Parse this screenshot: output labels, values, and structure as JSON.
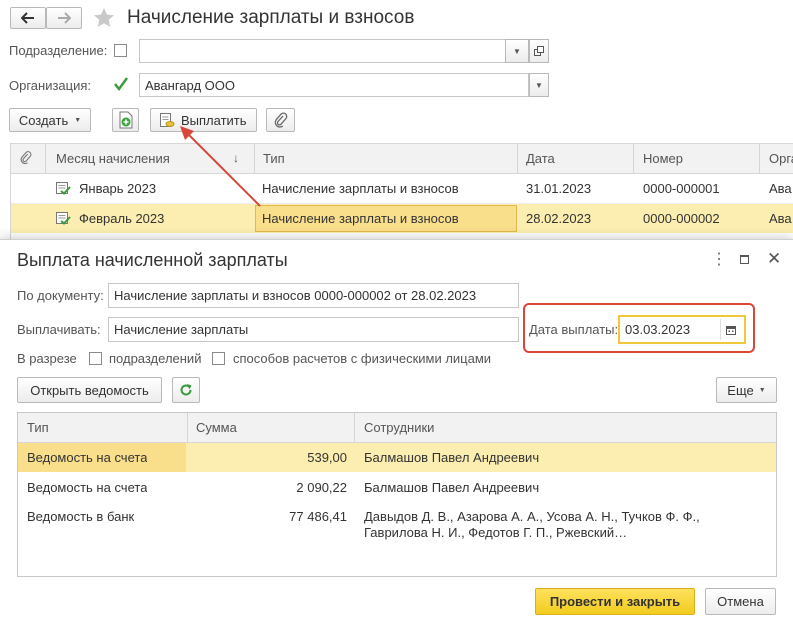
{
  "header": {
    "title": "Начисление зарплаты и взносов",
    "back_icon": "arrow-left-icon",
    "forward_icon": "arrow-right-icon",
    "star_icon": "star-icon"
  },
  "filters": {
    "department_label": "Подразделение:",
    "department_value": "",
    "organization_label": "Организация:",
    "organization_value": "Авангард ООО"
  },
  "toolbar": {
    "create_label": "Создать",
    "pay_label": "Выплатить"
  },
  "list": {
    "columns": [
      "Месяц начисления",
      "Тип",
      "Дата",
      "Номер",
      "Орга"
    ],
    "rows": [
      {
        "month": "Январь 2023",
        "type": "Начисление зарплаты и взносов",
        "date": "31.01.2023",
        "number": "0000-000001",
        "org": "Ава"
      },
      {
        "month": "Февраль 2023",
        "type": "Начисление зарплаты и взносов",
        "date": "28.02.2023",
        "number": "0000-000002",
        "org": "Ава"
      }
    ]
  },
  "dialog": {
    "title": "Выплата начисленной зарплаты",
    "doc_label": "По документу:",
    "doc_value": "Начисление зарплаты и взносов 0000-000002 от 28.02.2023",
    "pay_label": "Выплачивать:",
    "pay_value": "Начисление зарплаты",
    "pay_date_label": "Дата выплаты:",
    "pay_date_value": "03.03.2023",
    "section_label": "В разрезе",
    "by_departments_label": "подразделений",
    "by_methods_label": "способов расчетов с физическими лицами",
    "open_sheet_label": "Открыть ведомость",
    "more_label": "Еще",
    "table": {
      "columns": [
        "Тип",
        "Сумма",
        "Сотрудники"
      ],
      "rows": [
        {
          "type": "Ведомость на счета",
          "sum": "539,00",
          "employees": [
            "Балмашов Павел Андреевич"
          ]
        },
        {
          "type": "Ведомость на счета",
          "sum": "2 090,22",
          "employees": [
            "Балмашов Павел Андреевич"
          ]
        },
        {
          "type": "Ведомость в банк",
          "sum": "77 486,41",
          "employees": [
            "Давыдов Д. В., Азарова А. А., Усова А. Н., Тучков Ф. Ф.,",
            "Гаврилова Н. И., Федотов Г. П., Ржевский…"
          ]
        }
      ]
    },
    "submit_label": "Провести и закрыть",
    "cancel_label": "Отмена"
  },
  "colors": {
    "highlight_row": "#fbeeb0",
    "highlight_cell": "#f9df8c",
    "accent_yellow": "#f5d63a",
    "red_annotation": "#d9473a",
    "green_check": "#3a9a3a"
  }
}
